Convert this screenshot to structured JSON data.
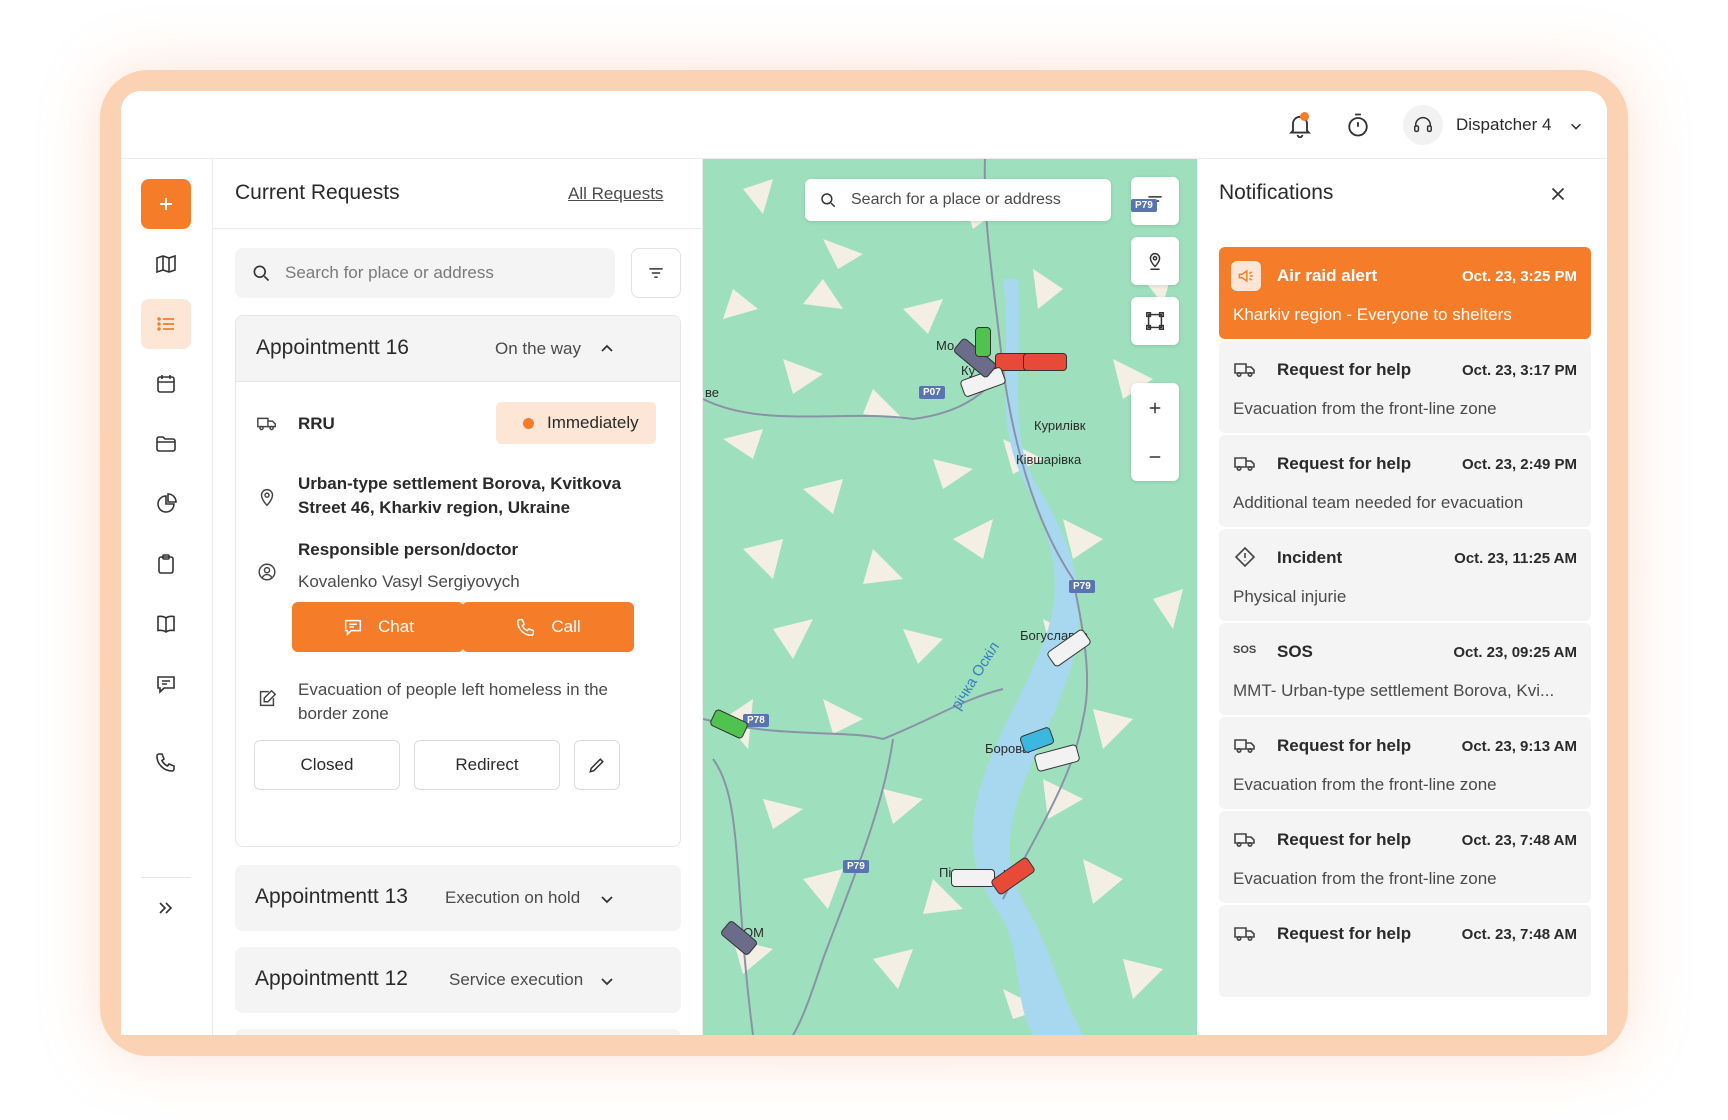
{
  "topbar": {
    "user_name": "Dispatcher 4",
    "icons": [
      "bell-icon",
      "timer-icon",
      "headset-icon",
      "chevron-down-icon"
    ],
    "notification_dot_color": "#f57c29"
  },
  "sidebar": {
    "items": [
      "add",
      "map",
      "list",
      "calendar",
      "folder",
      "chart",
      "clipboard",
      "book",
      "chat",
      "phone",
      "expand"
    ],
    "active": "list"
  },
  "requests": {
    "title": "Current Requests",
    "all_link": "All Requests",
    "search_placeholder": "Search for place or address",
    "open_appointment": {
      "name": "Appointmentt 16",
      "status": "On the way",
      "unit": "RRU",
      "priority": "Immediately",
      "address_line1": "Urban-type settlement Borova, Kvitkova",
      "address_line2": "Street 46, Kharkiv region, Ukraine",
      "responsible_label": "Responsible person/doctor",
      "responsible_name": "Kovalenko Vasyl Sergiyovych",
      "chat_label": "Chat",
      "call_label": "Call",
      "description_line1": "Evacuation of people left homeless in the",
      "description_line2": "border zone",
      "closed_label": "Closed",
      "redirect_label": "Redirect"
    },
    "collapsed": [
      {
        "name": "Appointmentt 13",
        "status": "Execution on hold"
      },
      {
        "name": "Appointmentt 12",
        "status": "Service execution"
      }
    ]
  },
  "map": {
    "search_placeholder": "Search for a place or address",
    "places": [
      "Мо",
      "Ку",
      "Курилівк",
      "Ківшарівка",
      "Богуславка",
      "Борова",
      "Пі",
      "ьк",
      "ве",
      "ОМ"
    ],
    "roads": [
      "P07",
      "P79",
      "P79",
      "P78",
      "P79"
    ],
    "river": "річка Оскіл",
    "colors": {
      "land": "#9ee0bd",
      "water": "#a8d8f0",
      "road": "#8a92a8",
      "patch": "#f4efe4"
    }
  },
  "notifications": {
    "title": "Notifications",
    "items": [
      {
        "type": "alert",
        "icon": "megaphone-icon",
        "title": "Air raid alert",
        "time": "Oct. 23, 3:25 PM",
        "body": "Kharkiv region - Everyone to shelters"
      },
      {
        "type": "help",
        "icon": "truck-icon",
        "title": "Request for help",
        "time": "Oct. 23, 3:17 PM",
        "body": "Evacuation from the front-line zone"
      },
      {
        "type": "help",
        "icon": "truck-icon",
        "title": "Request for help",
        "time": "Oct. 23, 2:49 PM",
        "body": "Additional team needed for evacuation"
      },
      {
        "type": "incident",
        "icon": "diamond-alert-icon",
        "title": "Incident",
        "time": "Oct. 23, 11:25 AM",
        "body": "Physical injurie"
      },
      {
        "type": "sos",
        "icon": "sos-icon",
        "icon_text": "SOS",
        "title": "SOS",
        "time": "Oct. 23, 09:25 AM",
        "body": "MMT- Urban-type settlement Borova, Kvi..."
      },
      {
        "type": "help",
        "icon": "truck-icon",
        "title": "Request for help",
        "time": "Oct. 23, 9:13 AM",
        "body": "Evacuation from the front-line zone"
      },
      {
        "type": "help",
        "icon": "truck-icon",
        "title": "Request for help",
        "time": "Oct. 23, 7:48 AM",
        "body": "Evacuation from the front-line zone"
      },
      {
        "type": "help",
        "icon": "truck-icon",
        "title": "Request for help",
        "time": "Oct. 23, 7:48 AM",
        "body": ""
      }
    ]
  },
  "accent_color": "#f57c29"
}
